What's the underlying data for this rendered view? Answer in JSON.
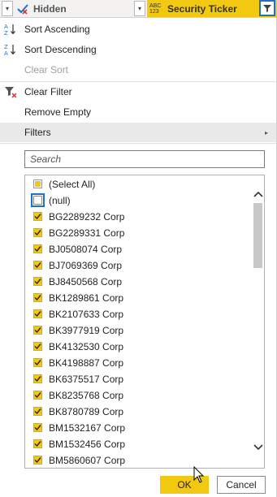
{
  "header": {
    "col_hidden_label": "Hidden",
    "col_ticker_type": "ABC 123",
    "col_ticker_label": "Security Ticker"
  },
  "menu": {
    "sort_asc": "Sort Ascending",
    "sort_desc": "Sort Descending",
    "clear_sort": "Clear Sort",
    "clear_filter": "Clear Filter",
    "remove_empty": "Remove Empty",
    "filters": "Filters"
  },
  "search": {
    "placeholder": "Search"
  },
  "list": {
    "select_all": "(Select All)",
    "null_label": "(null)",
    "items": [
      "BG2289232 Corp",
      "BG2289331 Corp",
      "BJ0508074 Corp",
      "BJ7069369 Corp",
      "BJ8450568 Corp",
      "BK1289861 Corp",
      "BK2107633 Corp",
      "BK3977919 Corp",
      "BK4132530 Corp",
      "BK4198887 Corp",
      "BK6375517 Corp",
      "BK8235768 Corp",
      "BK8780789 Corp",
      "BM1532167 Corp",
      "BM1532456 Corp",
      "BM5860607 Corp"
    ]
  },
  "buttons": {
    "ok": "OK",
    "cancel": "Cancel"
  },
  "colors": {
    "accent": "#f2c811",
    "focus": "#1e6fc9"
  }
}
